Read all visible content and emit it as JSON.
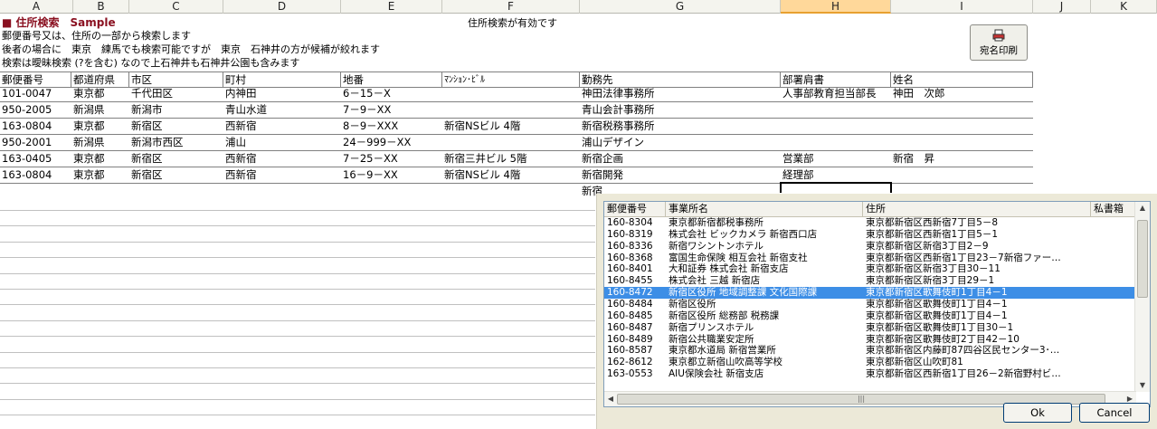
{
  "column_headers": [
    "A",
    "B",
    "C",
    "D",
    "E",
    "F",
    "G",
    "H",
    "I",
    "J",
    "K"
  ],
  "selected_column": "H",
  "title": "■ 住所検索　Sample",
  "status": "住所検索が有効です",
  "description": [
    "郵便番号又は、住所の一部から検索します",
    "後者の場合に　東京　練馬でも検索可能ですが　東京　石神井の方が候補が絞れます",
    "検索は曖昧検索 (?を含む) なので上石神井も石神井公園も含みます"
  ],
  "print_button_label": "宛名印刷",
  "table": {
    "headers": [
      "郵便番号",
      "都道府県",
      "市区",
      "町村",
      "地番",
      "ﾏﾝｼｮﾝ･ﾋﾞﾙ",
      "勤務先",
      "部署肩書",
      "姓名"
    ],
    "rows": [
      [
        "101-0047",
        "東京都",
        "千代田区",
        "内神田",
        "6－15－X",
        "",
        "神田法律事務所",
        "人事部教育担当部長",
        "神田　次郎"
      ],
      [
        "950-2005",
        "新潟県",
        "新潟市",
        "青山水道",
        "7－9－XX",
        "",
        "青山会計事務所",
        "",
        ""
      ],
      [
        "163-0804",
        "東京都",
        "新宿区",
        "西新宿",
        "8－9－XXX",
        "新宿NSビル 4階",
        "新宿税務事務所",
        "",
        ""
      ],
      [
        "950-2001",
        "新潟県",
        "新潟市西区",
        "浦山",
        "24－999－XX",
        "",
        "浦山デザイン",
        "",
        ""
      ],
      [
        "163-0405",
        "東京都",
        "新宿区",
        "西新宿",
        "7－25－XX",
        "新宿三井ビル 5階",
        "新宿企画",
        "営業部",
        "新宿　昇"
      ],
      [
        "163-0804",
        "東京都",
        "新宿区",
        "西新宿",
        "16－9－XX",
        "新宿NSビル 4階",
        "新宿開発",
        "経理部",
        ""
      ]
    ],
    "partial_cell": "新宿"
  },
  "popup": {
    "headers": [
      "郵便番号",
      "事業所名",
      "住所",
      "私書箱"
    ],
    "selected_index": 6,
    "rows": [
      [
        "160-8304",
        "東京都新宿都税事務所",
        "東京都新宿区西新宿7丁目5－8"
      ],
      [
        "160-8319",
        "株式会社 ビックカメラ 新宿西口店",
        "東京都新宿区西新宿1丁目5－1"
      ],
      [
        "160-8336",
        "新宿ワシントンホテル",
        "東京都新宿区新宿3丁目2－9"
      ],
      [
        "160-8368",
        "富国生命保険 相互会社 新宿支社",
        "東京都新宿区西新宿1丁目23－7新宿ファー…"
      ],
      [
        "160-8401",
        "大和証券 株式会社 新宿支店",
        "東京都新宿区新宿3丁目30－11"
      ],
      [
        "160-8455",
        "株式会社 三越 新宿店",
        "東京都新宿区新宿3丁目29－1"
      ],
      [
        "160-8472",
        "新宿区役所 地域調整課 文化国際課",
        "東京都新宿区歌舞伎町1丁目4－1"
      ],
      [
        "160-8484",
        "新宿区役所",
        "東京都新宿区歌舞伎町1丁目4－1"
      ],
      [
        "160-8485",
        "新宿区役所 総務部 税務課",
        "東京都新宿区歌舞伎町1丁目4－1"
      ],
      [
        "160-8487",
        "新宿プリンスホテル",
        "東京都新宿区歌舞伎町1丁目30－1"
      ],
      [
        "160-8489",
        "新宿公共職業安定所",
        "東京都新宿区歌舞伎町2丁目42－10"
      ],
      [
        "160-8587",
        "東京都水道局 新宿営業所",
        "東京都新宿区内藤町87四谷区民センター3･…"
      ],
      [
        "162-8612",
        "東京都立新宿山吹高等学校",
        "東京都新宿区山吹町81"
      ],
      [
        "163-0553",
        "AIU保険会社 新宿支店",
        "東京都新宿区西新宿1丁目26－2新宿野村ビ…"
      ]
    ],
    "ok_label": "Ok",
    "cancel_label": "Cancel"
  },
  "icons": {
    "print": "printer-icon"
  },
  "colors": {
    "title": "#8a1020",
    "selection": "#3d8ee6",
    "selected_column": "#ffd89a"
  }
}
